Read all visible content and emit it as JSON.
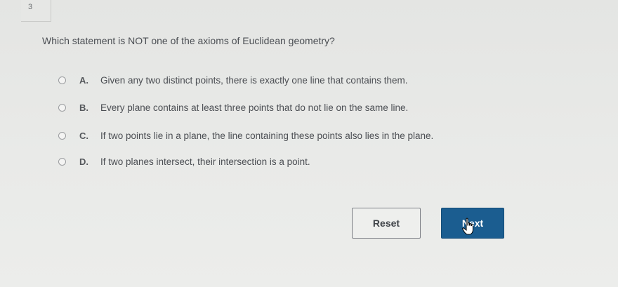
{
  "question": {
    "number": "3",
    "prompt": "Which statement is NOT one of the axioms of Euclidean geometry?"
  },
  "options": [
    {
      "letter": "A.",
      "text": "Given any two distinct points, there is exactly one line that contains them."
    },
    {
      "letter": "B.",
      "text": "Every plane contains at least three points that do not lie on the same line."
    },
    {
      "letter": "C.",
      "text": "If two points lie in a plane, the line containing these points also lies in the plane."
    },
    {
      "letter": "D.",
      "text": "If two planes intersect, their intersection is a point."
    }
  ],
  "buttons": {
    "reset_label": "Reset",
    "next_label": "Next"
  },
  "colors": {
    "next_button": "#1b5d90",
    "background": "#e8e9e7"
  },
  "icons": {
    "pointer": "hand-pointer-icon"
  }
}
